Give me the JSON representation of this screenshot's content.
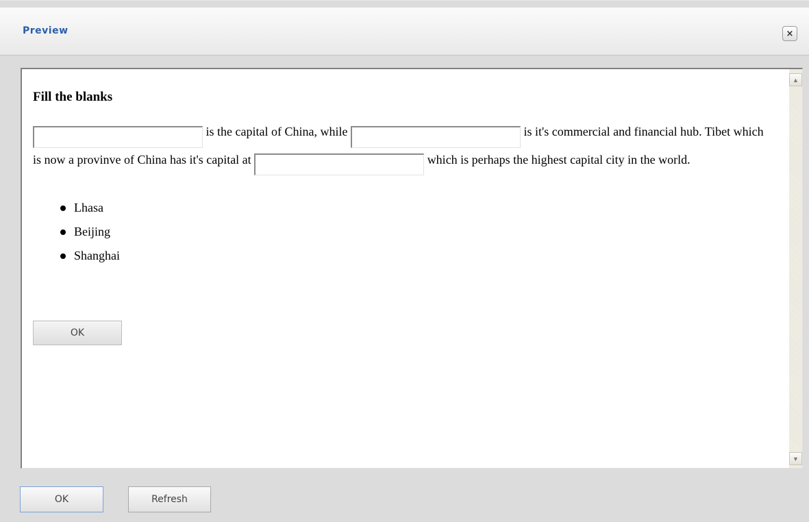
{
  "dialog": {
    "title": "Preview",
    "close_icon": "×"
  },
  "question": {
    "heading": "Fill the blanks",
    "text_1": " is the capital of China, while ",
    "text_2": " is it's commercial and financial hub. Tibet which is now a provinve of China has it's capital at ",
    "text_3": " which is perhaps the highest capital city in the world.",
    "blanks": [
      "",
      "",
      ""
    ],
    "options": [
      "Lhasa",
      "Beijing",
      "Shanghai"
    ],
    "ok_label": "OK"
  },
  "scrollbar": {
    "up_icon": "▲",
    "down_icon": "▼"
  },
  "footer": {
    "ok_label": "OK",
    "refresh_label": "Refresh"
  },
  "colors": {
    "title": "#2a5ea8",
    "dialog_bg": "#dcdcdc",
    "focus_border": "#7aa3d8"
  }
}
